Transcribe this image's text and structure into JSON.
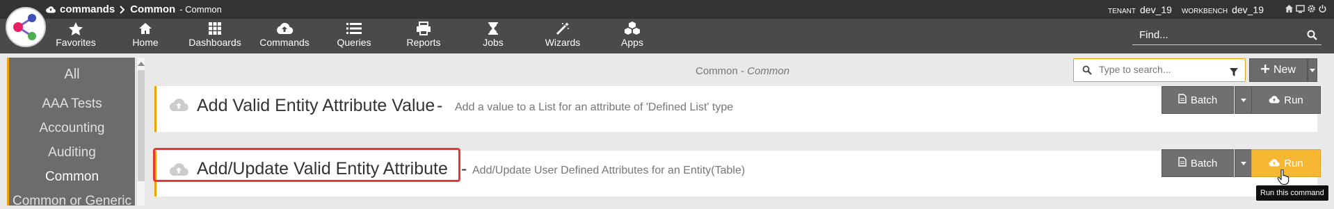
{
  "topbar": {
    "breadcrumb_root": "commands",
    "breadcrumb_current": "Common",
    "breadcrumb_sub": "- Common",
    "tenant_label": "TENANT",
    "tenant_value": "dev_19",
    "workbench_label": "WORKBENCH",
    "workbench_value": "dev_19"
  },
  "nav": {
    "items": [
      {
        "label": "Favorites",
        "icon": "star-icon"
      },
      {
        "label": "Home",
        "icon": "home-icon"
      },
      {
        "label": "Dashboards",
        "icon": "grid-icon"
      },
      {
        "label": "Commands",
        "icon": "cloud-upload-icon"
      },
      {
        "label": "Queries",
        "icon": "list-icon"
      },
      {
        "label": "Reports",
        "icon": "printer-icon"
      },
      {
        "label": "Jobs",
        "icon": "hourglass-icon"
      },
      {
        "label": "Wizards",
        "icon": "magic-wand-icon"
      },
      {
        "label": "Apps",
        "icon": "cubes-icon"
      }
    ],
    "find_placeholder": "Find..."
  },
  "sidebar": {
    "items": [
      "All",
      "AAA Tests",
      "Accounting",
      "Auditing",
      "Common",
      "Common or Generic"
    ],
    "active": "Common"
  },
  "header": {
    "context_prefix": "Common -",
    "context_italic": "Common",
    "search_placeholder": "Type to search...",
    "new_label": "New"
  },
  "commands": [
    {
      "title": "Add Valid Entity Attribute Value",
      "separator": "-",
      "description": "Add a value to a List for an attribute of 'Defined List' type",
      "batch_label": "Batch",
      "run_label": "Run"
    },
    {
      "title": "Add/Update Valid Entity Attribute",
      "separator": "-",
      "description": "Add/Update User Defined Attributes for an Entity(Table)",
      "batch_label": "Batch",
      "run_label": "Run"
    }
  ],
  "tooltip": "Run this command",
  "colors": {
    "accent": "#f0a100",
    "run_active": "#f6b733",
    "highlight": "#e53935",
    "topbar": "#333333",
    "navbar": "#4a4a4a"
  }
}
